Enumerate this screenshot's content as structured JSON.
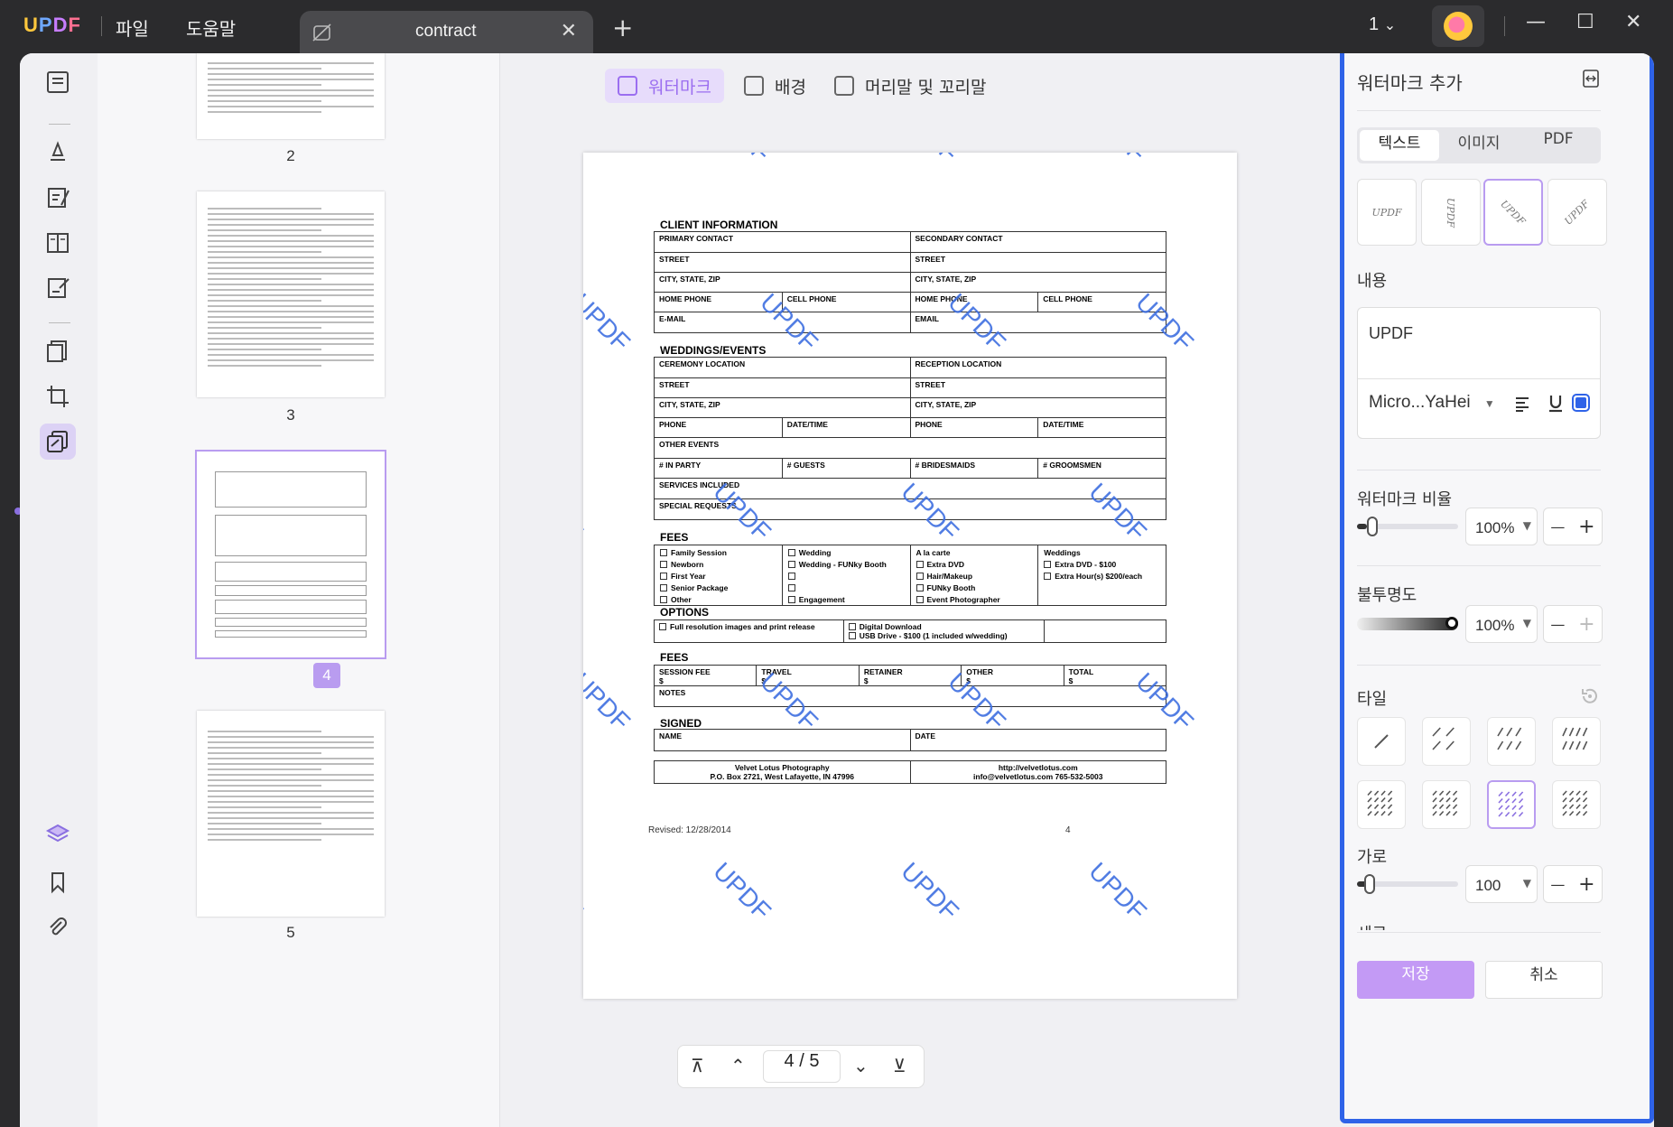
{
  "titlebar": {
    "logo": "UPDF",
    "menu_file": "파일",
    "menu_help": "도움말",
    "tab_name": "contract",
    "tab_close": "✕",
    "add_tab": "+",
    "page_selector": "1",
    "minimize": "—",
    "maximize": "☐",
    "close": "✕"
  },
  "thumbnails": [
    {
      "label": "2",
      "selected": false
    },
    {
      "label": "3",
      "selected": false
    },
    {
      "label": "4",
      "selected": true
    },
    {
      "label": "5",
      "selected": false
    }
  ],
  "toolbar": {
    "watermark": "워터마크",
    "background": "배경",
    "header_footer": "머리말 및 꼬리말"
  },
  "document": {
    "client_info": "CLIENT INFORMATION",
    "primary_contact": "PRIMARY CONTACT",
    "secondary_contact": "SECONDARY CONTACT",
    "street": "STREET",
    "city_state_zip": "CITY, STATE, ZIP",
    "home_phone": "HOME PHONE",
    "cell_phone": "CELL PHONE",
    "email_1": "E-MAIL",
    "email_2": "EMAIL",
    "weddings_events": "WEDDINGS/EVENTS",
    "ceremony_location": "CEREMONY LOCATION",
    "reception_location": "RECEPTION LOCATION",
    "phone": "PHONE",
    "date_time": "DATE/TIME",
    "other_events": "OTHER EVENTS",
    "in_party": "# IN PARTY",
    "guests": "# GUESTS",
    "bridesmaids": "# BRIDESMAIDS",
    "groomsmen": "# GROOMSMEN",
    "services_included": "SERVICES INCLUDED",
    "special_requests": "SPECIAL REQUESTS",
    "fees_title": "FEES",
    "fees_col1": [
      "Family Session",
      "Newborn",
      "First Year",
      "Senior Package",
      "Other"
    ],
    "fees_col2": [
      "Wedding",
      "Wedding - FUNky Booth",
      "",
      "",
      "Engagement"
    ],
    "fees_col3_head": "A la carte",
    "fees_col3": [
      "Extra DVD",
      "Hair/Makeup",
      "FUNky Booth",
      "Event Photographer"
    ],
    "fees_col4_head": "Weddings",
    "fees_col4": [
      "Extra DVD - $100",
      "Extra Hour(s) $200/each"
    ],
    "options_title": "OPTIONS",
    "opt1": "Full resolution images and print release",
    "opt2": "Digital Download",
    "opt3": "USB Drive - $100 (1 included w/wedding)",
    "fees2_title": "FEES",
    "session_fee": "SESSION FEE",
    "travel": "TRAVEL",
    "retainer": "RETAINER",
    "other": "OTHER",
    "total": "TOTAL",
    "dollar": "$",
    "notes": "NOTES",
    "signed_title": "SIGNED",
    "name": "NAME",
    "date": "DATE",
    "company_name": "Velvet Lotus Photography",
    "company_addr": "P.O. Box 2721, West Lafayette, IN 47996",
    "company_url": "http://velvetlotus.com",
    "company_email": "info@velvetlotus.com 765-532-5003",
    "revised": "Revised: 12/28/2014",
    "page_no": "4",
    "watermark_text": "UPDF"
  },
  "pagenav": {
    "current": "4 / 5"
  },
  "panel": {
    "title": "워터마크 추가",
    "tab_text": "텍스트",
    "tab_image": "이미지",
    "tab_pdf": "PDF",
    "style_sample": "UPDF",
    "content_label": "내용",
    "content_value": "UPDF",
    "font": "Micro...YaHei",
    "ratio_label": "워터마크 비율",
    "ratio_value": "100%",
    "ratio": 0.1,
    "opacity_label": "불투명도",
    "opacity_value": "100%",
    "opacity": 1.0,
    "tile_label": "타일",
    "horizontal_label": "가로",
    "horizontal_value": "100",
    "vertical_label": "세로",
    "save": "저장",
    "cancel": "취소",
    "minus": "—",
    "plus": "+",
    "accent": "#b99cf0",
    "highlight": "#2f63e8"
  }
}
